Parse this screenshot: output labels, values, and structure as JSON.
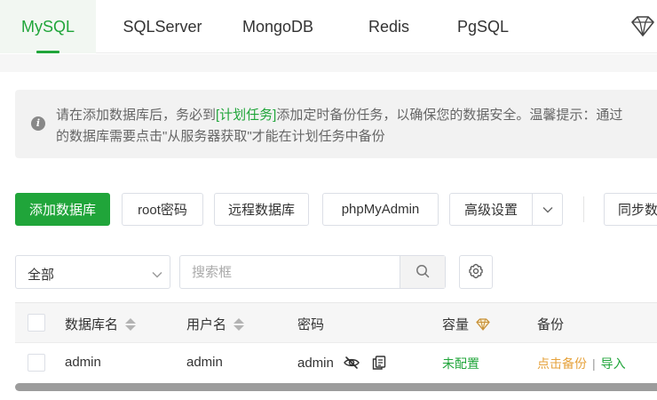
{
  "tabs": [
    {
      "label": "MySQL",
      "active": true
    },
    {
      "label": "SQLServer",
      "active": false
    },
    {
      "label": "MongoDB",
      "active": false
    },
    {
      "label": "Redis",
      "active": false
    },
    {
      "label": "PgSQL",
      "active": false
    }
  ],
  "notice": {
    "text_before": "请在添加数据库后，务必到",
    "link": "[计划任务]",
    "text_after": "添加定时备份任务，以确保您的数据安全。温馨提示：通过",
    "line2": "的数据库需要点击\"从服务器获取\"才能在计划任务中备份"
  },
  "toolbar": {
    "add_db": "添加数据库",
    "root_pwd": "root密码",
    "remote_db": "远程数据库",
    "phpmyadmin": "phpMyAdmin",
    "advanced": "高级设置",
    "sync": "同步数"
  },
  "filter": {
    "select_value": "全部",
    "search_placeholder": "搜索框"
  },
  "table": {
    "columns": {
      "name": "数据库名",
      "user": "用户名",
      "password": "密码",
      "capacity": "容量",
      "backup": "备份"
    },
    "rows": [
      {
        "name": "admin",
        "user": "admin",
        "password": "admin",
        "capacity": "未配置",
        "backup_action": "点击备份",
        "import_action": "导入"
      }
    ]
  },
  "colors": {
    "accent": "#20a53a",
    "backup_orange": "#e6a23c",
    "premium_gold": "#d4a54a"
  },
  "icons": [
    "diamond-icon",
    "info-icon",
    "chevron-down-icon",
    "search-icon",
    "gear-icon",
    "eye-off-icon",
    "copy-icon",
    "crown-icon",
    "sort-icon"
  ]
}
